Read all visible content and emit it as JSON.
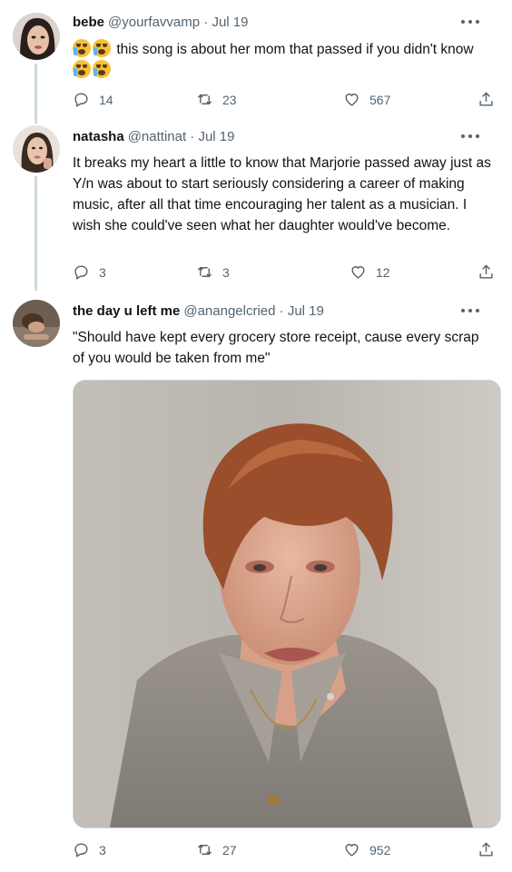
{
  "tweets": [
    {
      "name": "bebe",
      "handle": "@yourfavvamp · Jul 19",
      "text": "this song is about her mom that passed if you didn't know",
      "replies": "14",
      "retweets": "23",
      "likes": "567"
    },
    {
      "name": "natasha",
      "handle": "@nattinat · Jul 19",
      "text": "It breaks my heart a little to know that Marjorie passed away just as Y/n was about to start seriously considering a career of making music, after all that time encouraging her talent as a musician. I wish she could've seen what her daughter would've become.",
      "replies": "3",
      "retweets": "3",
      "likes": "12"
    },
    {
      "name": "the day u left me",
      "handle": "@anangelcried · Jul 19",
      "text": "\"Should have kept every grocery store receipt, cause every scrap of you would be taken from me\"",
      "replies": "3",
      "retweets": "27",
      "likes": "952"
    }
  ],
  "icons": {
    "reply": "reply-icon",
    "retweet": "retweet-icon",
    "like": "heart-icon",
    "share": "share-icon",
    "more": "more-icon"
  }
}
